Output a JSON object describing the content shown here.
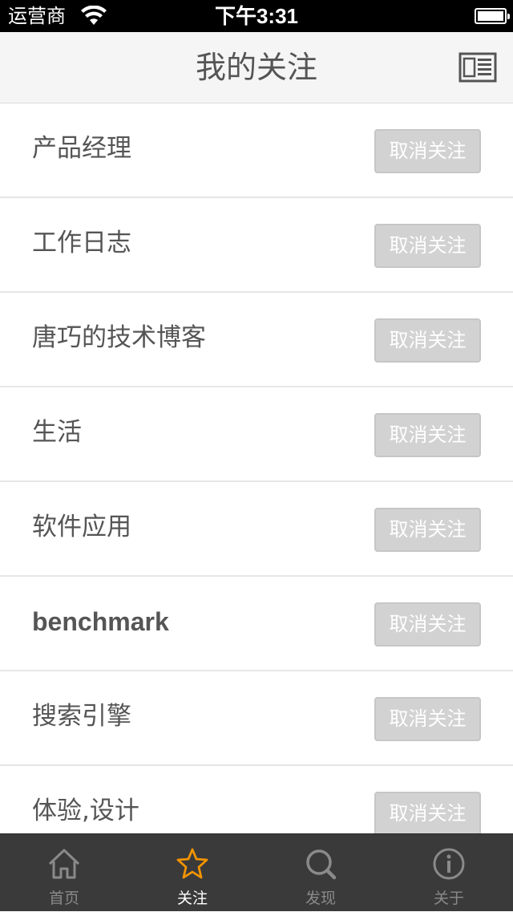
{
  "status_bar": {
    "carrier": "运营商",
    "time": "下午3:31"
  },
  "nav": {
    "title": "我的关注",
    "menu_icon": "list-view-icon"
  },
  "follow_list": {
    "items": [
      {
        "label": "产品经理",
        "button": "取消关注"
      },
      {
        "label": "工作日志",
        "button": "取消关注"
      },
      {
        "label": "唐巧的技术博客",
        "button": "取消关注"
      },
      {
        "label": "生活",
        "button": "取消关注"
      },
      {
        "label": "软件应用",
        "button": "取消关注"
      },
      {
        "label": "benchmark",
        "button": "取消关注"
      },
      {
        "label": "搜索引擎",
        "button": "取消关注"
      },
      {
        "label": "体验,设计",
        "button": "取消关注"
      }
    ]
  },
  "tab_bar": {
    "tabs": [
      {
        "label": "首页",
        "icon": "home-icon",
        "active": false
      },
      {
        "label": "关注",
        "icon": "star-icon",
        "active": true
      },
      {
        "label": "发现",
        "icon": "search-icon",
        "active": false
      },
      {
        "label": "关于",
        "icon": "info-icon",
        "active": false
      }
    ],
    "active_color": "#f29400",
    "inactive_color": "#8a8a8a"
  }
}
